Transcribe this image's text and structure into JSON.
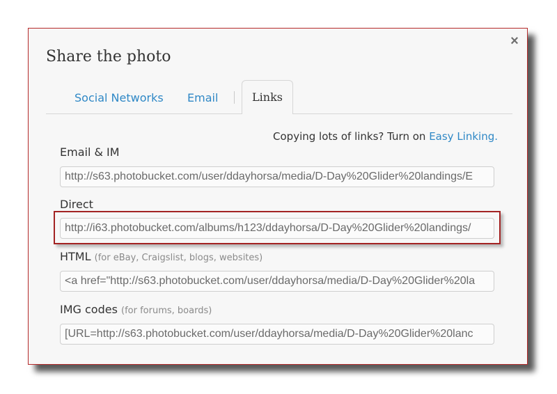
{
  "dialog": {
    "title": "Share the photo",
    "close_label": "×",
    "tabs": [
      {
        "label": "Social Networks"
      },
      {
        "label": "Email"
      },
      {
        "label": "Links"
      }
    ],
    "active_tab": "Links",
    "hint": {
      "text": "Copying lots of links? Turn on ",
      "link": "Easy Linking."
    },
    "fields": [
      {
        "label": "Email & IM",
        "note": "",
        "value": "http://s63.photobucket.com/user/ddayhorsa/media/D-Day%20Glider%20landings/E"
      },
      {
        "label": "Direct",
        "note": "",
        "value": "http://i63.photobucket.com/albums/h123/ddayhorsa/D-Day%20Glider%20landings/"
      },
      {
        "label": "HTML",
        "note": "(for eBay, Craigslist, blogs, websites)",
        "value": "<a href=\"http://s63.photobucket.com/user/ddayhorsa/media/D-Day%20Glider%20la"
      },
      {
        "label": "IMG codes",
        "note": "(for forums, boards)",
        "value": "[URL=http://s63.photobucket.com/user/ddayhorsa/media/D-Day%20Glider%20lanc"
      }
    ]
  },
  "colors": {
    "link": "#2f88c6",
    "highlight_border": "#a32323",
    "dialog_border": "#b52a2a"
  }
}
